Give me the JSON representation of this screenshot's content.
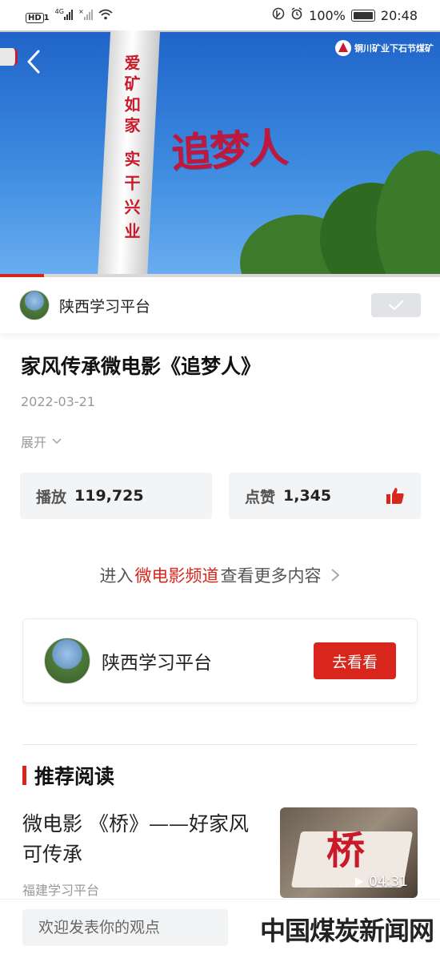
{
  "status_bar": {
    "network_badge": "HD",
    "network_badge_num": "1",
    "network_4g": "4G",
    "network_x": "×",
    "battery_percent": "100%",
    "time": "20:48"
  },
  "video": {
    "overlay_title": "追梦人",
    "chimney_text": [
      "爱矿如家",
      "实干兴业"
    ],
    "logo_text": "铜川矿业下石节煤矿",
    "progress": 0.1,
    "colors": {
      "accent": "#d9261c"
    }
  },
  "channel": {
    "name": "陕西学习平台",
    "followed": true
  },
  "article": {
    "title": "家风传承微电影《追梦人》",
    "date": "2022-03-21",
    "expand_label": "展开",
    "plays_label": "播放",
    "plays_value": "119,725",
    "likes_label": "点赞",
    "likes_value": "1,345"
  },
  "channel_link": {
    "prefix": "进入",
    "channel": "微电影频道",
    "suffix": "查看更多内容"
  },
  "card": {
    "name": "陕西学习平台",
    "button_label": "去看看"
  },
  "recommended": {
    "section_title": "推荐阅读",
    "items": [
      {
        "title": "微电影 《桥》——好家风可传承",
        "source": "福建学习平台",
        "thumb_text": "桥",
        "duration": "04:31"
      }
    ]
  },
  "bottom_bar": {
    "comment_placeholder": "欢迎发表你的观点",
    "watermark": "中国煤炭新闻网"
  }
}
